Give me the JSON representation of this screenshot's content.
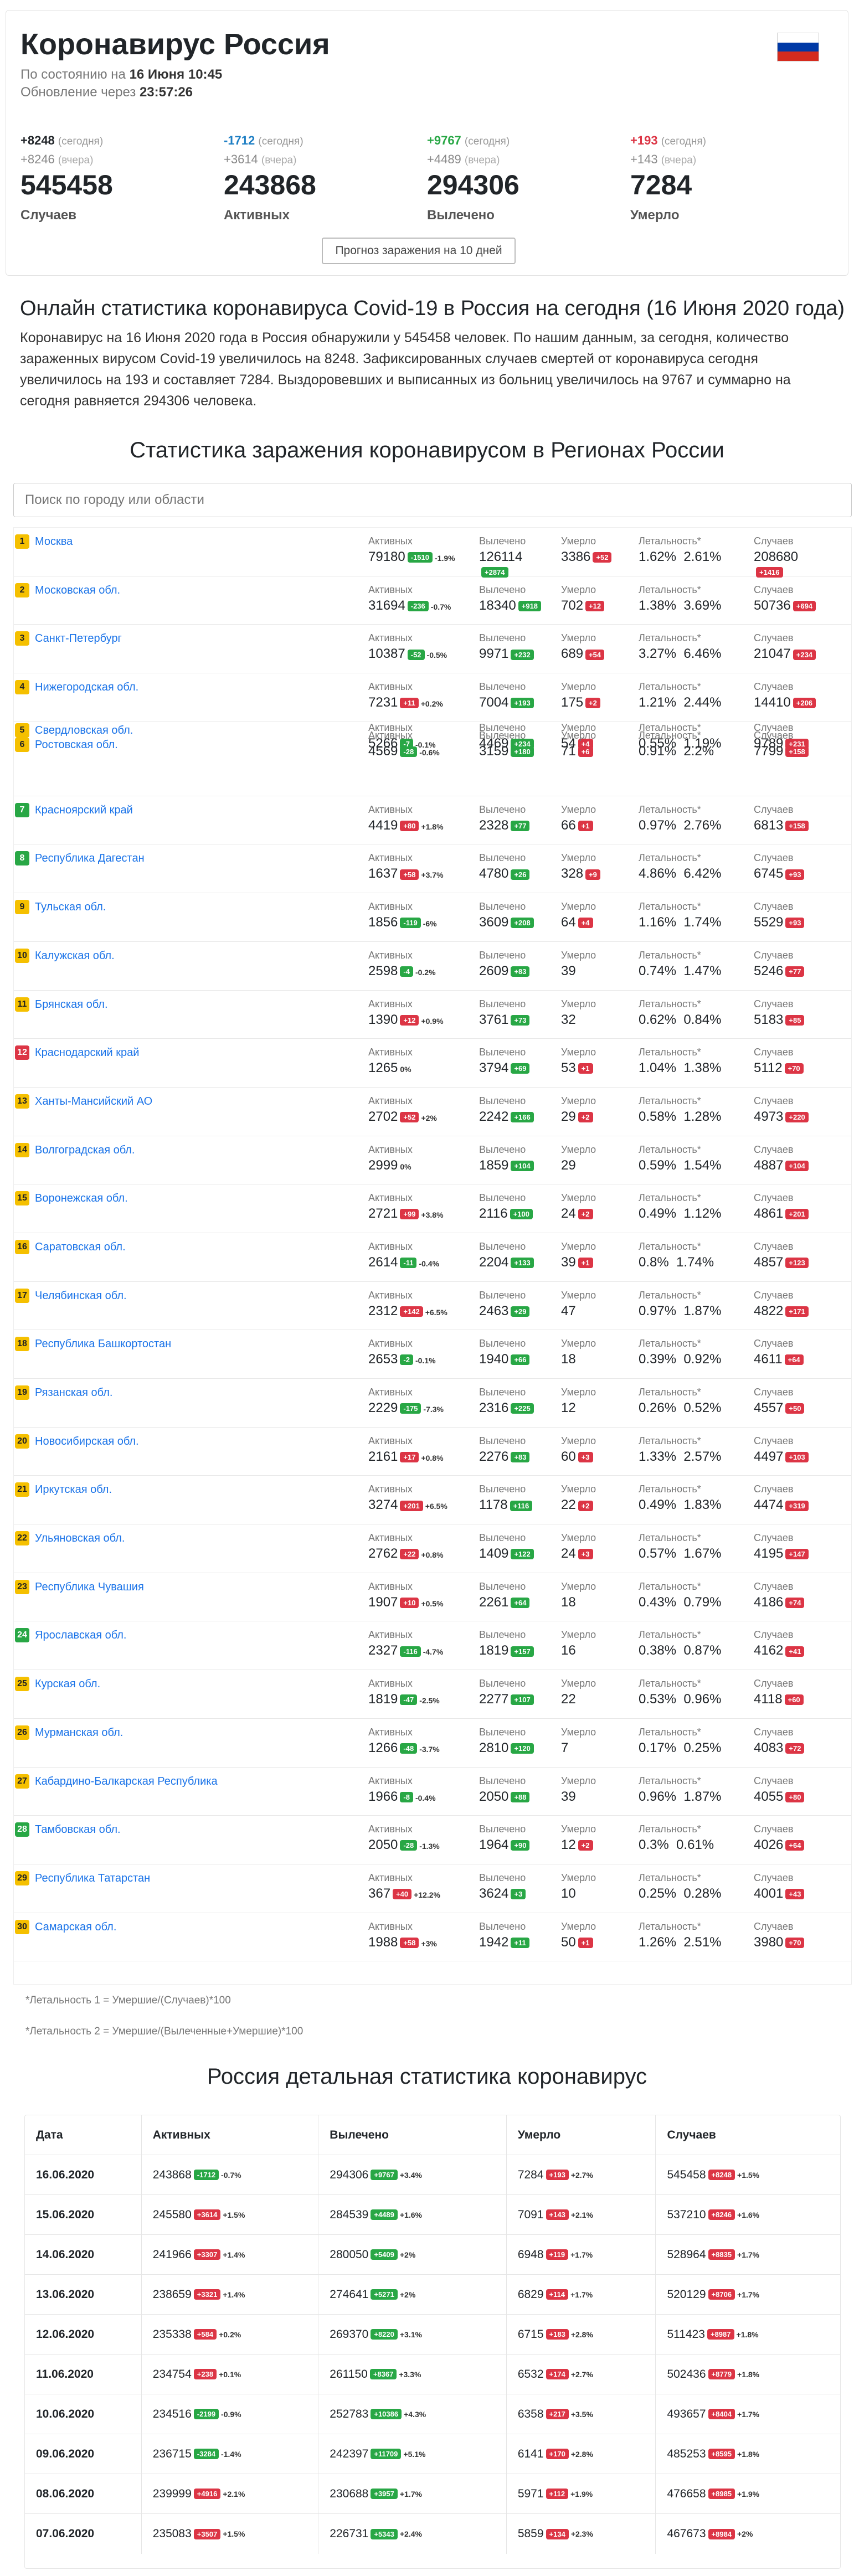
{
  "header": {
    "title": "Коронавирус Россия",
    "as_of_label": "По состоянию на",
    "as_of_date": "16 Июня 10:45",
    "update_label": "Обновление через",
    "update_timer": "23:57:26",
    "flag_colors": [
      "#ffffff",
      "#0039a6",
      "#d52b1e"
    ]
  },
  "stats": [
    {
      "today": "+8248",
      "today_color": "#212529",
      "today_label": "(сегодня)",
      "yesterday": "+8246",
      "yesterday_label": "(вчера)",
      "total": "545458",
      "label": "Случаев"
    },
    {
      "today": "-1712",
      "today_color": "#1e7fc4",
      "today_label": "(сегодня)",
      "yesterday": "+3614",
      "yesterday_label": "(вчера)",
      "total": "243868",
      "label": "Активных"
    },
    {
      "today": "+9767",
      "today_color": "#28a745",
      "today_label": "(сегодня)",
      "yesterday": "+4489",
      "yesterday_label": "(вчера)",
      "total": "294306",
      "label": "Вылечено"
    },
    {
      "today": "+193",
      "today_color": "#dc3545",
      "today_label": "(сегодня)",
      "yesterday": "+143",
      "yesterday_label": "(вчера)",
      "total": "7284",
      "label": "Умерло"
    }
  ],
  "forecast_button": "Прогноз заражения на 10 дней",
  "intro": {
    "title": "Онлайн статистика коронавируса Covid-19 в Россия на сегодня (16 Июня 2020 года)",
    "text": "Коронавирус на 16 Июня 2020 года в Россия обнаружили у 545458 человек. По нашим данным, за сегодня, количество зараженных вирусом Covid-19 увеличилось на 8248. Зафиксированных случаев смертей от коронавируса сегодня увеличилось на 193 и составляет 7284. Выздоровевших и выписанных из больниц увеличилось на 9767 и суммарно на сегодня равняется 294306 человека."
  },
  "regions_title": "Статистика заражения коронавирусом в Регионах России",
  "search": {
    "placeholder": "Поиск по городу или области"
  },
  "labels": {
    "active": "Активных",
    "recovered": "Вылечено",
    "died": "Умерло",
    "lethality": "Летальность*",
    "cases": "Случаев"
  },
  "regions": [
    {
      "n": "1",
      "nc": "y",
      "name": "Москва",
      "active": "79180",
      "ad": "-1510",
      "adc": "g",
      "ap": "-1.9%",
      "rec": "126114",
      "rd": "+2874",
      "rdc": "g",
      "died": "3386",
      "dd": "+52",
      "ddc": "r",
      "l1": "1.62%",
      "l2": "2.61%",
      "cases": "208680",
      "cd": "+1416",
      "cdc": "r"
    },
    {
      "n": "2",
      "nc": "y",
      "name": "Московская обл.",
      "active": "31694",
      "ad": "-236",
      "adc": "g",
      "ap": "-0.7%",
      "rec": "18340",
      "rd": "+918",
      "rdc": "g",
      "died": "702",
      "dd": "+12",
      "ddc": "r",
      "l1": "1.38%",
      "l2": "3.69%",
      "cases": "50736",
      "cd": "+694",
      "cdc": "r"
    },
    {
      "n": "3",
      "nc": "y",
      "name": "Санкт-Петербург",
      "active": "10387",
      "ad": "-52",
      "adc": "g",
      "ap": "-0.5%",
      "rec": "9971",
      "rd": "+232",
      "rdc": "g",
      "died": "689",
      "dd": "+54",
      "ddc": "r",
      "l1": "3.27%",
      "l2": "6.46%",
      "cases": "21047",
      "cd": "+234",
      "cdc": "r"
    },
    {
      "n": "4",
      "nc": "y",
      "name": "Нижегородская обл.",
      "active": "7231",
      "ad": "+11",
      "adc": "r",
      "ap": "+0.2%",
      "rec": "7004",
      "rd": "+193",
      "rdc": "g",
      "died": "175",
      "dd": "+2",
      "ddc": "r",
      "l1": "1.21%",
      "l2": "2.44%",
      "cases": "14410",
      "cd": "+206",
      "cdc": "r"
    },
    {
      "n": "5",
      "nc": "y",
      "name": "Свердловская обл.",
      "active": "5266",
      "ad": "-7",
      "adc": "g",
      "ap": "-0.1%",
      "rec": "4469",
      "rd": "+234",
      "rdc": "g",
      "died": "54",
      "dd": "+4",
      "ddc": "r",
      "l1": "0.55%",
      "l2": "1.19%",
      "cases": "9789",
      "cd": "+231",
      "cdc": "r"
    },
    {
      "n": "6",
      "nc": "y",
      "name": "Ростовская обл.",
      "active": "4569",
      "ad": "-28",
      "adc": "g",
      "ap": "-0.6%",
      "rec": "3159",
      "rd": "+180",
      "rdc": "g",
      "died": "71",
      "dd": "+6",
      "ddc": "r",
      "l1": "0.91%",
      "l2": "2.2%",
      "cases": "7799",
      "cd": "+158",
      "cdc": "r"
    },
    {
      "n": "7",
      "nc": "g",
      "name": "Красноярский край",
      "active": "4419",
      "ad": "+80",
      "adc": "r",
      "ap": "+1.8%",
      "rec": "2328",
      "rd": "+77",
      "rdc": "g",
      "died": "66",
      "dd": "+1",
      "ddc": "r",
      "l1": "0.97%",
      "l2": "2.76%",
      "cases": "6813",
      "cd": "+158",
      "cdc": "r"
    },
    {
      "n": "8",
      "nc": "g",
      "name": "Республика Дагестан",
      "active": "1637",
      "ad": "+58",
      "adc": "r",
      "ap": "+3.7%",
      "rec": "4780",
      "rd": "+26",
      "rdc": "g",
      "died": "328",
      "dd": "+9",
      "ddc": "r",
      "l1": "4.86%",
      "l2": "6.42%",
      "cases": "6745",
      "cd": "+93",
      "cdc": "r"
    },
    {
      "n": "9",
      "nc": "y",
      "name": "Тульская обл.",
      "active": "1856",
      "ad": "-119",
      "adc": "g",
      "ap": "-6%",
      "rec": "3609",
      "rd": "+208",
      "rdc": "g",
      "died": "64",
      "dd": "+4",
      "ddc": "r",
      "l1": "1.16%",
      "l2": "1.74%",
      "cases": "5529",
      "cd": "+93",
      "cdc": "r"
    },
    {
      "n": "10",
      "nc": "y",
      "name": "Калужская обл.",
      "active": "2598",
      "ad": "-4",
      "adc": "g",
      "ap": "-0.2%",
      "rec": "2609",
      "rd": "+83",
      "rdc": "g",
      "died": "39",
      "dd": "",
      "ddc": "",
      "l1": "0.74%",
      "l2": "1.47%",
      "cases": "5246",
      "cd": "+77",
      "cdc": "r"
    },
    {
      "n": "11",
      "nc": "y",
      "name": "Брянская обл.",
      "active": "1390",
      "ad": "+12",
      "adc": "r",
      "ap": "+0.9%",
      "rec": "3761",
      "rd": "+73",
      "rdc": "g",
      "died": "32",
      "dd": "",
      "ddc": "",
      "l1": "0.62%",
      "l2": "0.84%",
      "cases": "5183",
      "cd": "+85",
      "cdc": "r"
    },
    {
      "n": "12",
      "nc": "r",
      "name": "Краснодарский край",
      "active": "1265",
      "ad": "",
      "adc": "",
      "ap": "0%",
      "rec": "3794",
      "rd": "+69",
      "rdc": "g",
      "died": "53",
      "dd": "+1",
      "ddc": "r",
      "l1": "1.04%",
      "l2": "1.38%",
      "cases": "5112",
      "cd": "+70",
      "cdc": "r"
    },
    {
      "n": "13",
      "nc": "y",
      "name": "Ханты-Мансийский АО",
      "active": "2702",
      "ad": "+52",
      "adc": "r",
      "ap": "+2%",
      "rec": "2242",
      "rd": "+166",
      "rdc": "g",
      "died": "29",
      "dd": "+2",
      "ddc": "r",
      "l1": "0.58%",
      "l2": "1.28%",
      "cases": "4973",
      "cd": "+220",
      "cdc": "r"
    },
    {
      "n": "14",
      "nc": "y",
      "name": "Волгоградская обл.",
      "active": "2999",
      "ad": "",
      "adc": "",
      "ap": "0%",
      "rec": "1859",
      "rd": "+104",
      "rdc": "g",
      "died": "29",
      "dd": "",
      "ddc": "",
      "l1": "0.59%",
      "l2": "1.54%",
      "cases": "4887",
      "cd": "+104",
      "cdc": "r"
    },
    {
      "n": "15",
      "nc": "y",
      "name": "Воронежская обл.",
      "active": "2721",
      "ad": "+99",
      "adc": "r",
      "ap": "+3.8%",
      "rec": "2116",
      "rd": "+100",
      "rdc": "g",
      "died": "24",
      "dd": "+2",
      "ddc": "r",
      "l1": "0.49%",
      "l2": "1.12%",
      "cases": "4861",
      "cd": "+201",
      "cdc": "r"
    },
    {
      "n": "16",
      "nc": "y",
      "name": "Саратовская обл.",
      "active": "2614",
      "ad": "-11",
      "adc": "g",
      "ap": "-0.4%",
      "rec": "2204",
      "rd": "+133",
      "rdc": "g",
      "died": "39",
      "dd": "+1",
      "ddc": "r",
      "l1": "0.8%",
      "l2": "1.74%",
      "cases": "4857",
      "cd": "+123",
      "cdc": "r"
    },
    {
      "n": "17",
      "nc": "y",
      "name": "Челябинская обл.",
      "active": "2312",
      "ad": "+142",
      "adc": "r",
      "ap": "+6.5%",
      "rec": "2463",
      "rd": "+29",
      "rdc": "g",
      "died": "47",
      "dd": "",
      "ddc": "",
      "l1": "0.97%",
      "l2": "1.87%",
      "cases": "4822",
      "cd": "+171",
      "cdc": "r"
    },
    {
      "n": "18",
      "nc": "y",
      "name": "Республика Башкортостан",
      "active": "2653",
      "ad": "-2",
      "adc": "g",
      "ap": "-0.1%",
      "rec": "1940",
      "rd": "+66",
      "rdc": "g",
      "died": "18",
      "dd": "",
      "ddc": "",
      "l1": "0.39%",
      "l2": "0.92%",
      "cases": "4611",
      "cd": "+64",
      "cdc": "r"
    },
    {
      "n": "19",
      "nc": "y",
      "name": "Рязанская обл.",
      "active": "2229",
      "ad": "-175",
      "adc": "g",
      "ap": "-7.3%",
      "rec": "2316",
      "rd": "+225",
      "rdc": "g",
      "died": "12",
      "dd": "",
      "ddc": "",
      "l1": "0.26%",
      "l2": "0.52%",
      "cases": "4557",
      "cd": "+50",
      "cdc": "r"
    },
    {
      "n": "20",
      "nc": "y",
      "name": "Новосибирская обл.",
      "active": "2161",
      "ad": "+17",
      "adc": "r",
      "ap": "+0.8%",
      "rec": "2276",
      "rd": "+83",
      "rdc": "g",
      "died": "60",
      "dd": "+3",
      "ddc": "r",
      "l1": "1.33%",
      "l2": "2.57%",
      "cases": "4497",
      "cd": "+103",
      "cdc": "r"
    },
    {
      "n": "21",
      "nc": "y",
      "name": "Иркутская обл.",
      "active": "3274",
      "ad": "+201",
      "adc": "r",
      "ap": "+6.5%",
      "rec": "1178",
      "rd": "+116",
      "rdc": "g",
      "died": "22",
      "dd": "+2",
      "ddc": "r",
      "l1": "0.49%",
      "l2": "1.83%",
      "cases": "4474",
      "cd": "+319",
      "cdc": "r"
    },
    {
      "n": "22",
      "nc": "y",
      "name": "Ульяновская обл.",
      "active": "2762",
      "ad": "+22",
      "adc": "r",
      "ap": "+0.8%",
      "rec": "1409",
      "rd": "+122",
      "rdc": "g",
      "died": "24",
      "dd": "+3",
      "ddc": "r",
      "l1": "0.57%",
      "l2": "1.67%",
      "cases": "4195",
      "cd": "+147",
      "cdc": "r"
    },
    {
      "n": "23",
      "nc": "y",
      "name": "Республика Чувашия",
      "active": "1907",
      "ad": "+10",
      "adc": "r",
      "ap": "+0.5%",
      "rec": "2261",
      "rd": "+64",
      "rdc": "g",
      "died": "18",
      "dd": "",
      "ddc": "",
      "l1": "0.43%",
      "l2": "0.79%",
      "cases": "4186",
      "cd": "+74",
      "cdc": "r"
    },
    {
      "n": "24",
      "nc": "g",
      "name": "Ярославская обл.",
      "active": "2327",
      "ad": "-116",
      "adc": "g",
      "ap": "-4.7%",
      "rec": "1819",
      "rd": "+157",
      "rdc": "g",
      "died": "16",
      "dd": "",
      "ddc": "",
      "l1": "0.38%",
      "l2": "0.87%",
      "cases": "4162",
      "cd": "+41",
      "cdc": "r"
    },
    {
      "n": "25",
      "nc": "y",
      "name": "Курская обл.",
      "active": "1819",
      "ad": "-47",
      "adc": "g",
      "ap": "-2.5%",
      "rec": "2277",
      "rd": "+107",
      "rdc": "g",
      "died": "22",
      "dd": "",
      "ddc": "",
      "l1": "0.53%",
      "l2": "0.96%",
      "cases": "4118",
      "cd": "+60",
      "cdc": "r"
    },
    {
      "n": "26",
      "nc": "y",
      "name": "Мурманская обл.",
      "active": "1266",
      "ad": "-48",
      "adc": "g",
      "ap": "-3.7%",
      "rec": "2810",
      "rd": "+120",
      "rdc": "g",
      "died": "7",
      "dd": "",
      "ddc": "",
      "l1": "0.17%",
      "l2": "0.25%",
      "cases": "4083",
      "cd": "+72",
      "cdc": "r"
    },
    {
      "n": "27",
      "nc": "y",
      "name": "Кабардино-Балкарская Республика",
      "active": "1966",
      "ad": "-8",
      "adc": "g",
      "ap": "-0.4%",
      "rec": "2050",
      "rd": "+88",
      "rdc": "g",
      "died": "39",
      "dd": "",
      "ddc": "",
      "l1": "0.96%",
      "l2": "1.87%",
      "cases": "4055",
      "cd": "+80",
      "cdc": "r"
    },
    {
      "n": "28",
      "nc": "g",
      "name": "Тамбовская обл.",
      "active": "2050",
      "ad": "-28",
      "adc": "g",
      "ap": "-1.3%",
      "rec": "1964",
      "rd": "+90",
      "rdc": "g",
      "died": "12",
      "dd": "+2",
      "ddc": "r",
      "l1": "0.3%",
      "l2": "0.61%",
      "cases": "4026",
      "cd": "+64",
      "cdc": "r"
    },
    {
      "n": "29",
      "nc": "y",
      "name": "Республика Татарстан",
      "active": "367",
      "ad": "+40",
      "adc": "r",
      "ap": "+12.2%",
      "rec": "3624",
      "rd": "+3",
      "rdc": "g",
      "died": "10",
      "dd": "",
      "ddc": "",
      "l1": "0.25%",
      "l2": "0.28%",
      "cases": "4001",
      "cd": "+43",
      "cdc": "r"
    },
    {
      "n": "30",
      "nc": "y",
      "name": "Самарская обл.",
      "active": "1988",
      "ad": "+58",
      "adc": "r",
      "ap": "+3%",
      "rec": "1942",
      "rd": "+11",
      "rdc": "g",
      "died": "50",
      "dd": "+1",
      "ddc": "r",
      "l1": "1.26%",
      "l2": "2.51%",
      "cases": "3980",
      "cd": "+70",
      "cdc": "r"
    }
  ],
  "notes": [
    "*Летальность 1 = Умершие/(Случаев)*100",
    "*Летальность 2 = Умершие/(Вылеченные+Умершие)*100"
  ],
  "detail": {
    "title": "Россия детальная статистика коронавирус",
    "headers": [
      "Дата",
      "Активных",
      "Вылечено",
      "Умерло",
      "Случаев"
    ],
    "rows": [
      {
        "date": "16.06.2020",
        "a": "243868",
        "ab": "-1712",
        "abc": "g",
        "ap": "-0.7%",
        "r": "294306",
        "rb": "+9767",
        "rbc": "g",
        "rp": "+3.4%",
        "d": "7284",
        "db": "+193",
        "dbc": "r",
        "dp": "+2.7%",
        "c": "545458",
        "cb": "+8248",
        "cbc": "r",
        "cp": "+1.5%"
      },
      {
        "date": "15.06.2020",
        "a": "245580",
        "ab": "+3614",
        "abc": "r",
        "ap": "+1.5%",
        "r": "284539",
        "rb": "+4489",
        "rbc": "g",
        "rp": "+1.6%",
        "d": "7091",
        "db": "+143",
        "dbc": "r",
        "dp": "+2.1%",
        "c": "537210",
        "cb": "+8246",
        "cbc": "r",
        "cp": "+1.6%"
      },
      {
        "date": "14.06.2020",
        "a": "241966",
        "ab": "+3307",
        "abc": "r",
        "ap": "+1.4%",
        "r": "280050",
        "rb": "+5409",
        "rbc": "g",
        "rp": "+2%",
        "d": "6948",
        "db": "+119",
        "dbc": "r",
        "dp": "+1.7%",
        "c": "528964",
        "cb": "+8835",
        "cbc": "r",
        "cp": "+1.7%"
      },
      {
        "date": "13.06.2020",
        "a": "238659",
        "ab": "+3321",
        "abc": "r",
        "ap": "+1.4%",
        "r": "274641",
        "rb": "+5271",
        "rbc": "g",
        "rp": "+2%",
        "d": "6829",
        "db": "+114",
        "dbc": "r",
        "dp": "+1.7%",
        "c": "520129",
        "cb": "+8706",
        "cbc": "r",
        "cp": "+1.7%"
      },
      {
        "date": "12.06.2020",
        "a": "235338",
        "ab": "+584",
        "abc": "r",
        "ap": "+0.2%",
        "r": "269370",
        "rb": "+8220",
        "rbc": "g",
        "rp": "+3.1%",
        "d": "6715",
        "db": "+183",
        "dbc": "r",
        "dp": "+2.8%",
        "c": "511423",
        "cb": "+8987",
        "cbc": "r",
        "cp": "+1.8%"
      },
      {
        "date": "11.06.2020",
        "a": "234754",
        "ab": "+238",
        "abc": "r",
        "ap": "+0.1%",
        "r": "261150",
        "rb": "+8367",
        "rbc": "g",
        "rp": "+3.3%",
        "d": "6532",
        "db": "+174",
        "dbc": "r",
        "dp": "+2.7%",
        "c": "502436",
        "cb": "+8779",
        "cbc": "r",
        "cp": "+1.8%"
      },
      {
        "date": "10.06.2020",
        "a": "234516",
        "ab": "-2199",
        "abc": "g",
        "ap": "-0.9%",
        "r": "252783",
        "rb": "+10386",
        "rbc": "g",
        "rp": "+4.3%",
        "d": "6358",
        "db": "+217",
        "dbc": "r",
        "dp": "+3.5%",
        "c": "493657",
        "cb": "+8404",
        "cbc": "r",
        "cp": "+1.7%"
      },
      {
        "date": "09.06.2020",
        "a": "236715",
        "ab": "-3284",
        "abc": "g",
        "ap": "-1.4%",
        "r": "242397",
        "rb": "+11709",
        "rbc": "g",
        "rp": "+5.1%",
        "d": "6141",
        "db": "+170",
        "dbc": "r",
        "dp": "+2.8%",
        "c": "485253",
        "cb": "+8595",
        "cbc": "r",
        "cp": "+1.8%"
      },
      {
        "date": "08.06.2020",
        "a": "239999",
        "ab": "+4916",
        "abc": "r",
        "ap": "+2.1%",
        "r": "230688",
        "rb": "+3957",
        "rbc": "g",
        "rp": "+1.7%",
        "d": "5971",
        "db": "+112",
        "dbc": "r",
        "dp": "+1.9%",
        "c": "476658",
        "cb": "+8985",
        "cbc": "r",
        "cp": "+1.9%"
      },
      {
        "date": "07.06.2020",
        "a": "235083",
        "ab": "+3507",
        "abc": "r",
        "ap": "+1.5%",
        "r": "226731",
        "rb": "+5343",
        "rbc": "g",
        "rp": "+2.4%",
        "d": "5859",
        "db": "+134",
        "dbc": "r",
        "dp": "+2.3%",
        "c": "467673",
        "cb": "+8984",
        "cbc": "r",
        "cp": "+2%"
      }
    ]
  }
}
